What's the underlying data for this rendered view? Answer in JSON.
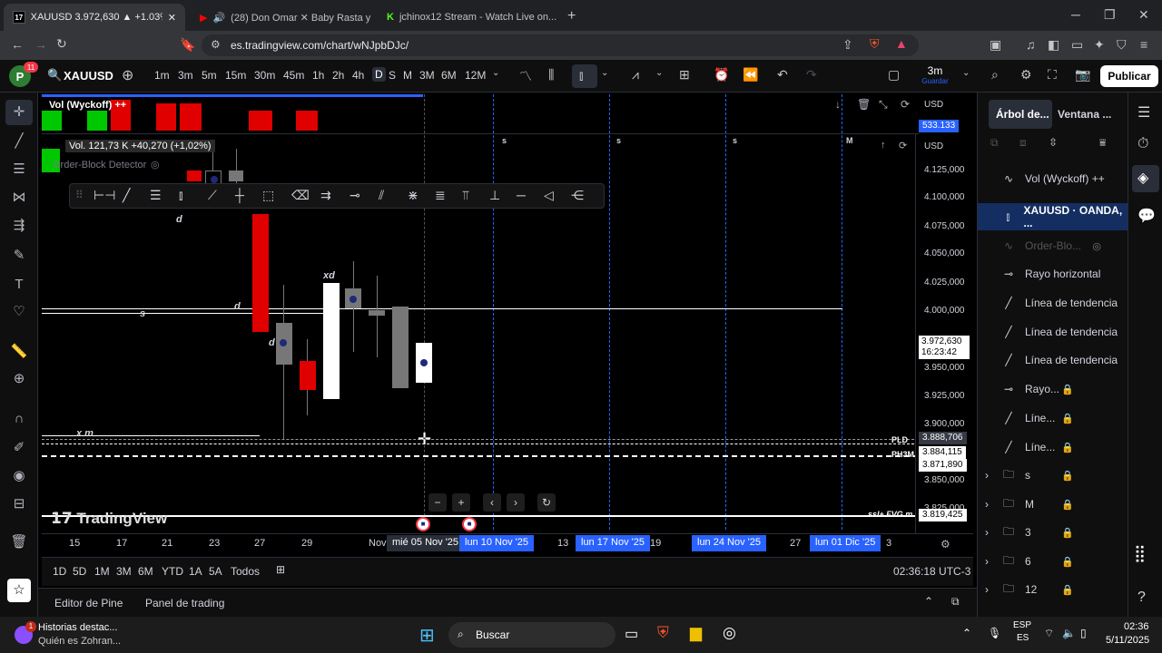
{
  "browser": {
    "tabs": [
      {
        "title": "XAUUSD 3.972,630 ▲ +1.03% 3..."
      },
      {
        "title": "(28) Don Omar ✕ Baby Rasta y G..."
      },
      {
        "title": "jchinox12 Stream - Watch Live on..."
      }
    ],
    "url": "es.tradingview.com/chart/wNJpbDJc/"
  },
  "toolbar": {
    "avatar_letter": "P",
    "avatar_badge": "11",
    "symbol": "XAUUSD",
    "timeframes": [
      "1m",
      "3m",
      "5m",
      "15m",
      "30m",
      "45m",
      "1h",
      "2h",
      "4h",
      "D",
      "S",
      "M",
      "3M",
      "6M",
      "12M"
    ],
    "selected_timeframe": "D",
    "save_interval": "3m",
    "save_label": "Guardar",
    "publish_label": "Publicar"
  },
  "chart": {
    "indicator_volume": "Vol (Wyckoff) ++",
    "volume_readout": "Vol. 121,73 K +40,270 (+1,02%)",
    "indicator_orderblock": "Order-Block Detector",
    "currency_top": "USD",
    "currency_main": "USD",
    "top_price_badge": "533.133",
    "price_ticks": [
      "4.125,000",
      "4.100,000",
      "4.075,000",
      "4.050,000",
      "4.025,000",
      "4.000,000",
      "3.950,000",
      "3.925,000",
      "3.900,000",
      "3.850,000",
      "3.825,000"
    ],
    "current_price": "3.972,630",
    "countdown": "16:23:42",
    "crosshair_price": "3.888,706",
    "level_ph3m": "3.884,115",
    "level_pdl": "3.871,890",
    "level_ssl": "3.819,425",
    "ph3m_label": "PH3M",
    "pdl_label": "PLD",
    "ssl_label": "ssl+ FVG m -",
    "annotations": {
      "s_top": "s",
      "d1": "d",
      "xd": "xd",
      "d2": "d",
      "d3": "d",
      "s_line": "s",
      "xm": "x m",
      "m": "M"
    },
    "x_dates": [
      "15",
      "17",
      "21",
      "23",
      "27",
      "29",
      "Nov",
      "13",
      "19",
      "27",
      "3"
    ],
    "x_highlight": [
      "mié 05 Nov '25",
      "lun 10 Nov '25",
      "lun 17 Nov '25",
      "lun 24 Nov '25",
      "lun 01 Dic '25"
    ],
    "watermark": "TradingView"
  },
  "range_bar": {
    "ranges": [
      "1D",
      "5D",
      "1M",
      "3M",
      "6M",
      "YTD",
      "1A",
      "5A",
      "Todos"
    ],
    "clock": "02:36:18 UTC-3"
  },
  "bottom_panel": {
    "pine_editor": "Editor de Pine",
    "trading_panel": "Panel de trading"
  },
  "sidebar": {
    "tab_tree": "Árbol de...",
    "tab_window": "Ventana ...",
    "items": [
      {
        "label": "Vol (Wyckoff) ++",
        "icon": "indicator-icon",
        "locked": false,
        "hidden": false
      },
      {
        "label": "XAUUSD · OANDA, ...",
        "icon": "candles-icon",
        "locked": false,
        "hidden": false,
        "selected": true
      },
      {
        "label": "Order-Blo...",
        "icon": "indicator-icon",
        "locked": false,
        "hidden": true
      },
      {
        "label": "Rayo horizontal",
        "icon": "ray-icon",
        "locked": false,
        "hidden": false
      },
      {
        "label": "Línea de tendencia",
        "icon": "trendline-icon",
        "locked": false,
        "hidden": false
      },
      {
        "label": "Línea de tendencia",
        "icon": "trendline-icon",
        "locked": false,
        "hidden": false
      },
      {
        "label": "Línea de tendencia",
        "icon": "trendline-icon",
        "locked": false,
        "hidden": false
      },
      {
        "label": "Rayo...",
        "icon": "ray-icon",
        "locked": true,
        "hidden": false
      },
      {
        "label": "Líne...",
        "icon": "trendline-icon",
        "locked": true,
        "hidden": false
      },
      {
        "label": "Líne...",
        "icon": "trendline-icon",
        "locked": true,
        "hidden": false
      },
      {
        "label": "s",
        "icon": "folder-icon",
        "locked": true,
        "hidden": false
      },
      {
        "label": "M",
        "icon": "folder-icon",
        "locked": true,
        "hidden": false
      },
      {
        "label": "3",
        "icon": "folder-icon",
        "locked": true,
        "hidden": false
      },
      {
        "label": "6",
        "icon": "folder-icon",
        "locked": true,
        "hidden": false
      },
      {
        "label": "12",
        "icon": "folder-icon",
        "locked": true,
        "hidden": false
      }
    ]
  },
  "taskbar": {
    "news_title": "Historias destac...",
    "news_sub": "Quién es Zohran...",
    "news_badge": "1",
    "search": "Buscar",
    "lang_top": "ESP",
    "lang_bottom": "ES",
    "time": "02:36",
    "date": "5/11/2025"
  }
}
